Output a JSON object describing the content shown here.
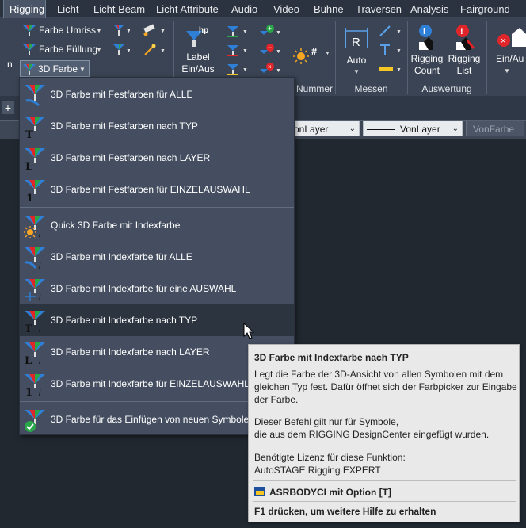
{
  "ribbon_tabs": [
    "Rigging",
    "Licht",
    "Licht Beam",
    "Licht Attribute",
    "Audio",
    "Video",
    "Bühne",
    "Traversen",
    "Analysis",
    "Fairground"
  ],
  "ribbon": {
    "farbe_umriss": "Farbe Umriss",
    "farbe_fuellung": "Farbe Füllung",
    "farbe_3d": "3D Farbe",
    "label_line1": "Label",
    "label_line2": "Ein/Aus",
    "nummer": "Nummer",
    "auto": "Auto",
    "rigging_count_1": "Rigging",
    "rigging_count_2": "Count",
    "rigging_list_1": "Rigging",
    "rigging_list_2": "List",
    "ein_aus": "Ein/Au",
    "panel_messen": "Messen",
    "panel_auswertung": "Auswertung",
    "left_n": "n"
  },
  "layer_bar": {
    "layer_combo": "onLayer",
    "linetype_combo": "VonLayer",
    "color_combo": "VonFarbe"
  },
  "menu": {
    "items": [
      "3D Farbe mit Festfarben für ALLE",
      "3D Farbe mit Festfarben nach TYP",
      "3D Farbe mit Festfarben nach LAYER",
      "3D Farbe mit Festfarben für EINZELAUSWAHL",
      "Quick 3D Farbe mit Indexfarbe",
      "3D Farbe mit Indexfarbe für ALLE",
      "3D Farbe mit Indexfarbe für eine AUSWAHL",
      "3D Farbe mit Indexfarbe nach TYP",
      "3D Farbe mit Indexfarbe nach LAYER",
      "3D Farbe mit Indexfarbe für EINZELAUSWAHL",
      "3D Farbe für das Einfügen von neuen Symbolen"
    ]
  },
  "tooltip": {
    "title": "3D Farbe mit Indexfarbe nach TYP",
    "desc1": "Legt die Farbe der 3D-Ansicht von allen Symbolen mit dem",
    "desc2": "gleichen Typ fest. Dafür öffnet sich der Farbpicker zur Eingabe",
    "desc3": "der Farbe.",
    "note1": "Dieser Befehl gilt nur für Symbole,",
    "note2": "die aus dem RIGGING DesignCenter eingefügt wurden.",
    "license1": "Benötigte Lizenz für diese Funktion:",
    "license2": "AutoSTAGE Rigging EXPERT",
    "command": "ASRBODYCI mit Option [T]",
    "help": "F1 drücken, um weitere Hilfe zu erhalten"
  },
  "colors": {
    "accent_red": "#e0262a",
    "accent_green": "#2aa64a",
    "accent_blue": "#2f7fd6",
    "menu_bg": "#444e60",
    "tooltip_bg": "#e9e9e9"
  }
}
